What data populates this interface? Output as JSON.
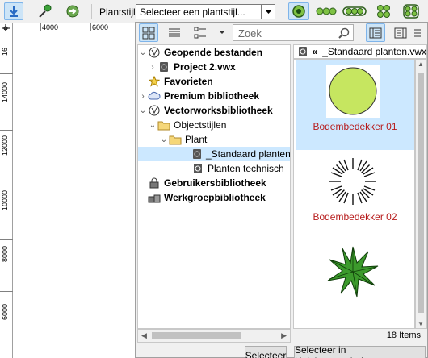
{
  "toolbar": {
    "plant_style_label": "Plantstijl:",
    "plant_style_value": "Selecteer een plantstijl..."
  },
  "ruler": {
    "top_ticks": [
      "4000",
      "6000"
    ],
    "left_ticks": [
      "16",
      "14000",
      "12000",
      "10000",
      "8000",
      "6000"
    ]
  },
  "panel": {
    "search_placeholder": "Zoek",
    "tree": [
      {
        "label": "Geopende bestanden",
        "bold": true
      },
      {
        "label": "Project 2.vwx",
        "bold": true
      },
      {
        "label": "Favorieten",
        "bold": true
      },
      {
        "label": "Premium bibliotheek",
        "bold": true
      },
      {
        "label": "Vectorworksbibliotheek",
        "bold": true
      },
      {
        "label": "Objectstijlen",
        "bold": false
      },
      {
        "label": "Plant",
        "bold": false
      },
      {
        "label": "_Standaard planten.vwx",
        "bold": false
      },
      {
        "label": "Planten technisch",
        "bold": false
      },
      {
        "label": "Gebruikersbibliotheek",
        "bold": true
      },
      {
        "label": "Werkgroepbibliotheek",
        "bold": true
      }
    ],
    "breadcrumb_back": "«",
    "breadcrumb_file": "_Standaard planten.vwx",
    "tiles": [
      {
        "caption": "Bodembedekker 01"
      },
      {
        "caption": "Bodembedekker 02"
      },
      {
        "caption": ""
      }
    ],
    "item_count": "18 Items",
    "select_button": "Selecteer",
    "select_in_manager_button": "Selecteer in Hulpbronnenbeheer"
  },
  "colors": {
    "accent": "#cce4f7",
    "selection": "#cce8ff",
    "caption_red": "#b71c1c",
    "plant_green": "#c6e660"
  }
}
